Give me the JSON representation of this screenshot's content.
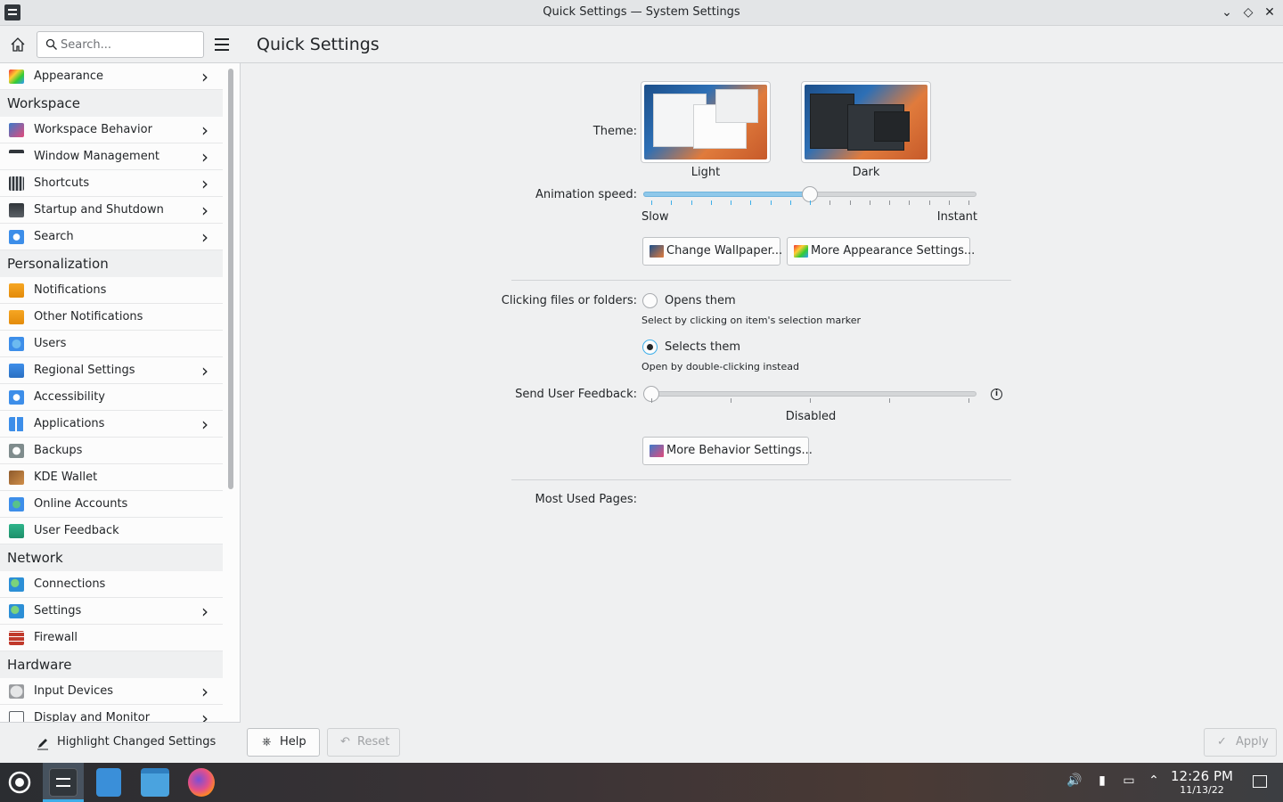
{
  "window": {
    "title": "Quick Settings — System Settings",
    "controls": {
      "minimize": "⌄",
      "maximize": "◇",
      "close": "✕"
    }
  },
  "sidebar": {
    "search_placeholder": "Search...",
    "items": [
      {
        "label": "Appearance",
        "icon": "appearance-icon",
        "has_children": true
      },
      {
        "section": "Workspace"
      },
      {
        "label": "Workspace Behavior",
        "icon": "workspace-behavior-icon",
        "has_children": true
      },
      {
        "label": "Window Management",
        "icon": "window-management-icon",
        "has_children": true
      },
      {
        "label": "Shortcuts",
        "icon": "keyboard-icon",
        "has_children": true
      },
      {
        "label": "Startup and Shutdown",
        "icon": "startup-icon",
        "has_children": true
      },
      {
        "label": "Search",
        "icon": "search-icon",
        "has_children": true
      },
      {
        "section": "Personalization"
      },
      {
        "label": "Notifications",
        "icon": "bell-icon",
        "has_children": false
      },
      {
        "label": "Other Notifications",
        "icon": "bell-icon",
        "has_children": false
      },
      {
        "label": "Users",
        "icon": "users-icon",
        "has_children": false
      },
      {
        "label": "Regional Settings",
        "icon": "flag-icon",
        "has_children": true
      },
      {
        "label": "Accessibility",
        "icon": "accessibility-icon",
        "has_children": false
      },
      {
        "label": "Applications",
        "icon": "applications-icon",
        "has_children": true
      },
      {
        "label": "Backups",
        "icon": "backups-icon",
        "has_children": false
      },
      {
        "label": "KDE Wallet",
        "icon": "wallet-icon",
        "has_children": false
      },
      {
        "label": "Online Accounts",
        "icon": "online-accounts-icon",
        "has_children": false
      },
      {
        "label": "User Feedback",
        "icon": "feedback-icon",
        "has_children": false
      },
      {
        "section": "Network"
      },
      {
        "label": "Connections",
        "icon": "globe-icon",
        "has_children": false
      },
      {
        "label": "Settings",
        "icon": "globe-icon",
        "has_children": true
      },
      {
        "label": "Firewall",
        "icon": "firewall-icon",
        "has_children": false
      },
      {
        "section": "Hardware"
      },
      {
        "label": "Input Devices",
        "icon": "mouse-icon",
        "has_children": true
      },
      {
        "label": "Display and Monitor",
        "icon": "monitor-icon",
        "has_children": true
      }
    ],
    "footer_label": "Highlight Changed Settings"
  },
  "main": {
    "title": "Quick Settings",
    "theme_label": "Theme:",
    "themes": [
      {
        "name": "Light"
      },
      {
        "name": "Dark"
      }
    ],
    "animation_label": "Animation speed:",
    "animation_value": 0.5,
    "animation_min": "Slow",
    "animation_max": "Instant",
    "change_wallpaper": "Change Wallpaper...",
    "more_appearance": "More Appearance Settings...",
    "clicking_label": "Clicking files or folders:",
    "opens_them": "Opens them",
    "opens_hint": "Select by clicking on item's selection marker",
    "selects_them": "Selects them",
    "selects_hint": "Open by double-clicking instead",
    "selected_option": "selects",
    "feedback_label": "Send User Feedback:",
    "feedback_value": 0,
    "feedback_state": "Disabled",
    "info": "i",
    "more_behavior": "More Behavior Settings...",
    "most_used_label": "Most Used Pages:"
  },
  "footer": {
    "help": "Help",
    "reset": "Reset",
    "apply": "Apply"
  },
  "taskbar": {
    "time": "12:26 PM",
    "date": "11/13/22"
  },
  "colors": {
    "accent": "#3daee9",
    "window_bg": "#eff0f1",
    "view_bg": "#fcfcfc"
  }
}
